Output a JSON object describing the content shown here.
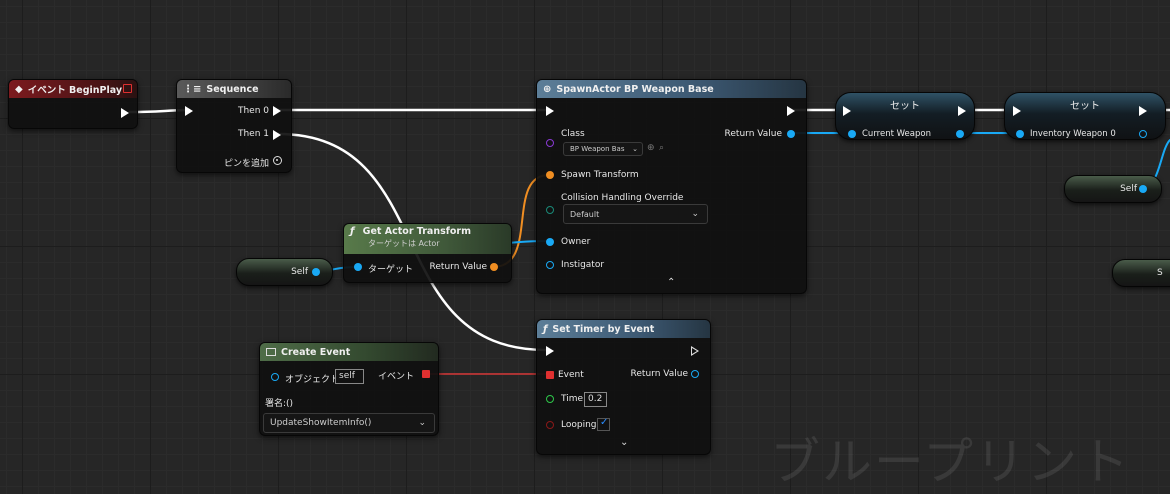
{
  "begin_play": {
    "title": "イベント BeginPlay"
  },
  "sequence": {
    "title": "Sequence",
    "then0": "Then 0",
    "then1": "Then 1",
    "add_pin": "ピンを追加"
  },
  "spawn": {
    "title": "SpawnActor BP Weapon Base",
    "class_label": "Class",
    "class_value": "BP Weapon Bas",
    "return_value": "Return Value",
    "spawn_transform": "Spawn Transform",
    "collision_label": "Collision Handling Override",
    "collision_value": "Default",
    "owner": "Owner",
    "instigator": "Instigator"
  },
  "get_transform": {
    "title": "Get Actor Transform",
    "subtitle": "ターゲットは Actor",
    "target": "ターゲット",
    "return_value": "Return Value"
  },
  "self_nodes": {
    "self1": "Self",
    "self2": "Self",
    "self3": "S"
  },
  "set1": {
    "title": "セット",
    "pin": "Current Weapon"
  },
  "set2": {
    "title": "セット",
    "pin": "Inventory Weapon 0"
  },
  "create_event": {
    "title": "Create Event",
    "object_label": "オブジェクト",
    "object_value": "self",
    "event_label": "イベント",
    "signature": "署名:()",
    "function_value": "UpdateShowItemInfo()"
  },
  "set_timer": {
    "title": "Set Timer by Event",
    "event": "Event",
    "return_value": "Return Value",
    "time_label": "Time",
    "time_value": "0.2",
    "looping_label": "Looping"
  },
  "watermark": "ブループリント",
  "colors": {
    "exec": "#ffffff",
    "object_pin": "#19a9f5",
    "struct_pin": "#f08e22",
    "delegate_pin": "#e03030",
    "float_pin": "#2ec84a",
    "bool_pin": "#8a1818"
  }
}
